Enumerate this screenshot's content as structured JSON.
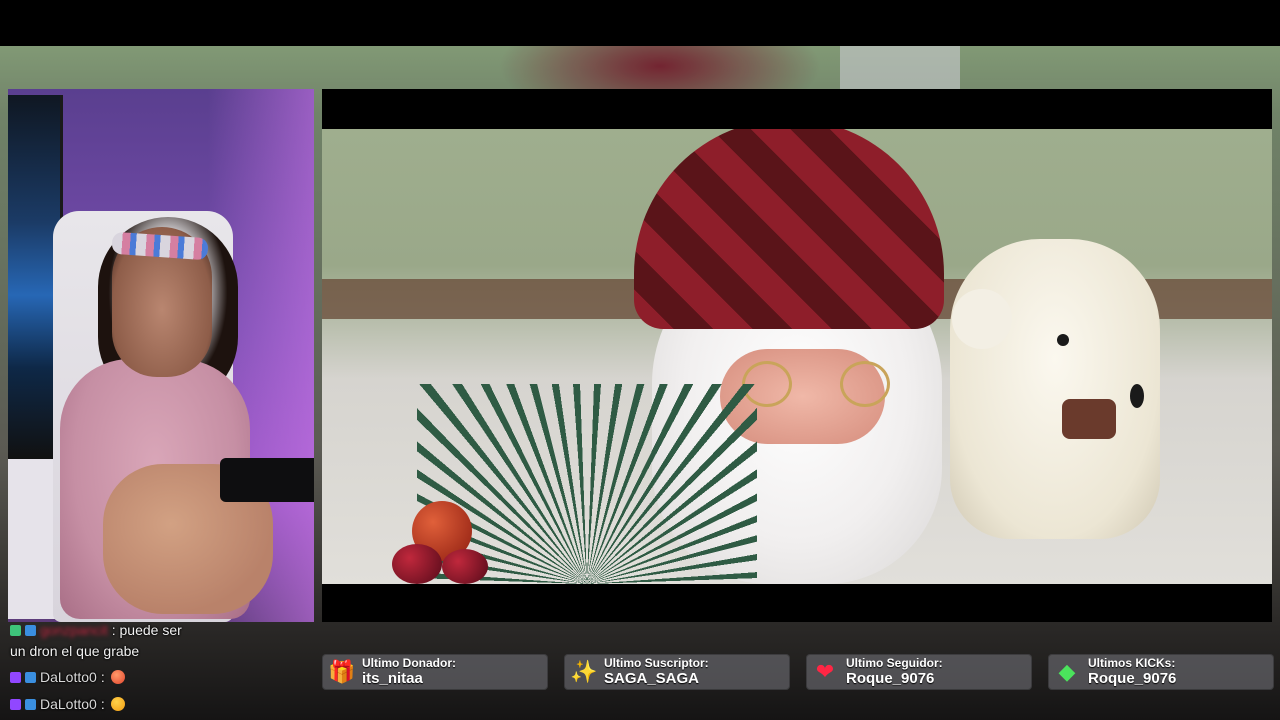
{
  "chat": {
    "messages": [
      {
        "user": "gonzpancit",
        "text": ": puede ser",
        "continuation": "un dron el que grabe",
        "user_hidden": true
      },
      {
        "user": "DaLotto0",
        "text": ":",
        "emote": "hot-face-emote"
      },
      {
        "user": "DaLotto0",
        "text": ":",
        "emote": "flushed-face-emote"
      }
    ]
  },
  "stats": [
    {
      "label": "Ultimo Donador:",
      "value": "its_nitaa",
      "icon": "gift-icon"
    },
    {
      "label": "Ultimo Suscriptor:",
      "value": "SAGA_SAGA",
      "icon": "sparkles-icon"
    },
    {
      "label": "Ultimo Seguidor:",
      "value": "Roque_9076",
      "icon": "heart-icon"
    },
    {
      "label": "Ultimos KICKs:",
      "value": "Roque_9076",
      "icon": "gem-icon"
    }
  ],
  "icons": {
    "gift": "🎁",
    "sparkles": "✨",
    "heart": "❤",
    "gem": "◆"
  }
}
